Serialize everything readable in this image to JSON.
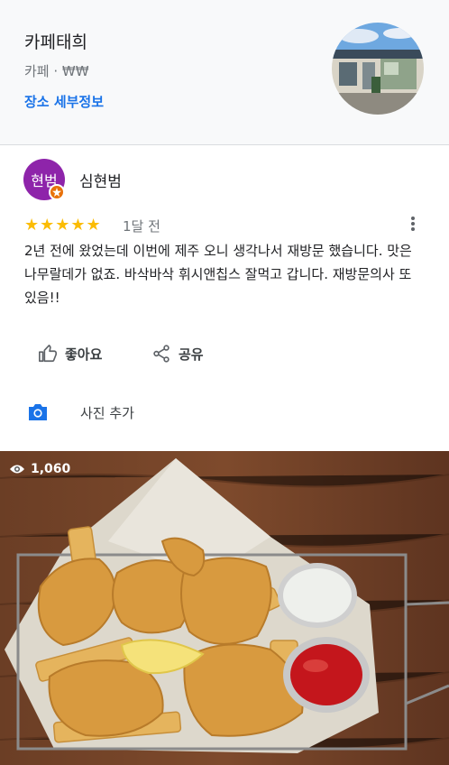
{
  "place": {
    "name": "카페태희",
    "meta": "카페 · ₩₩",
    "details_link": "장소 세부정보"
  },
  "review": {
    "avatar_text": "현범",
    "reviewer_name": "심현범",
    "rating": 5,
    "stars": "★★★★★",
    "time": "1달 전",
    "text": "2년 전에 왔었는데 이번에 제주 오니 생각나서 재방문 했습니다. 맛은 나무랄데가 없죠. 바삭바삭 휘시앤칩스 잘먹고 갑니다. 재방문의사 또 있음!!",
    "like_label": "좋아요",
    "share_label": "공유",
    "add_photo_label": "사진 추가"
  },
  "photo": {
    "views": "1,060"
  },
  "colors": {
    "accent": "#1a73e8",
    "star": "#fbbc04",
    "avatar": "#8e24aa",
    "badge": "#e8710a"
  }
}
